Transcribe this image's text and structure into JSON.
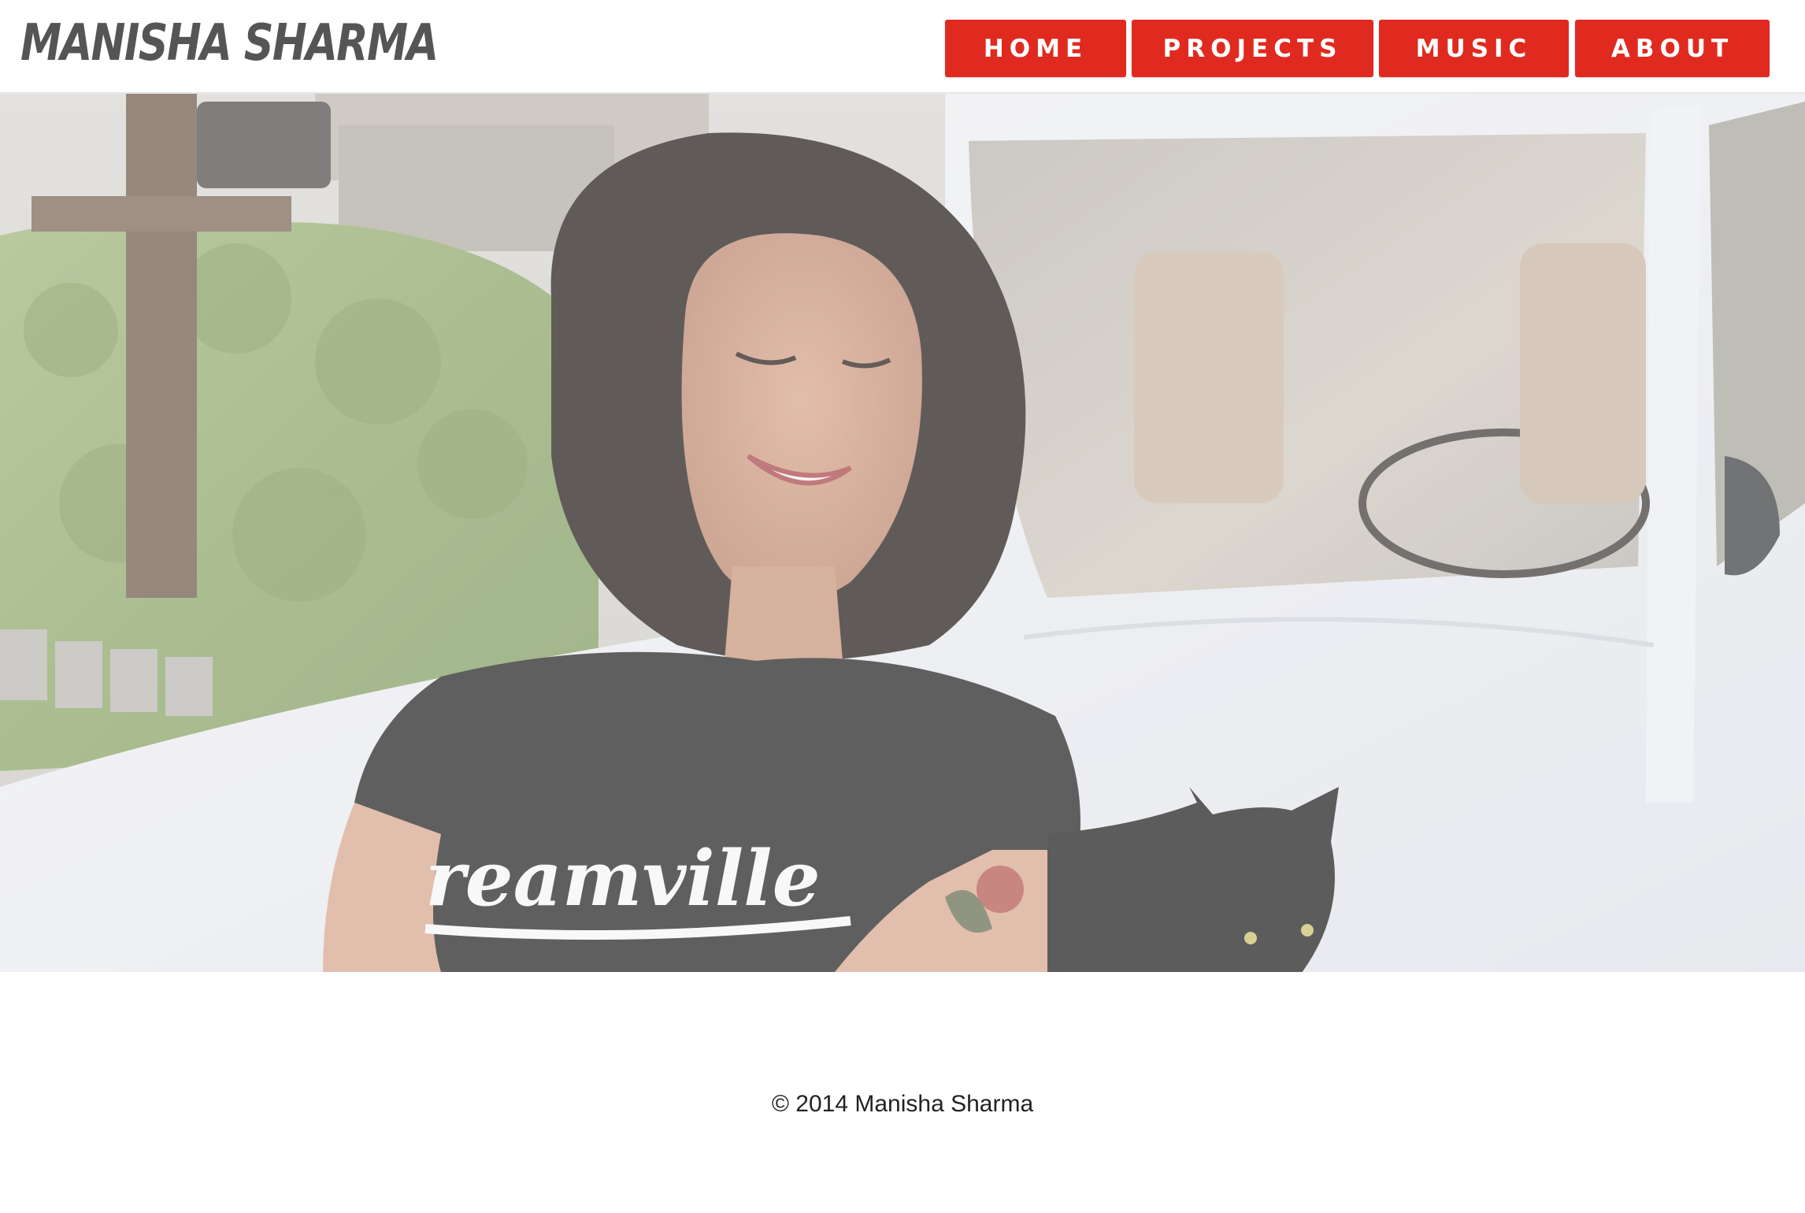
{
  "header": {
    "logo": "MANISHA SHARMA"
  },
  "nav": {
    "items": [
      {
        "label": "HOME"
      },
      {
        "label": "PROJECTS"
      },
      {
        "label": "MUSIC"
      },
      {
        "label": "ABOUT"
      }
    ]
  },
  "hero": {
    "shirt_text": "reamville"
  },
  "footer": {
    "copyright": "© 2014 Manisha Sharma"
  },
  "colors": {
    "nav_button": "#e02a20",
    "logo": "#555555",
    "background": "#ffffff"
  }
}
